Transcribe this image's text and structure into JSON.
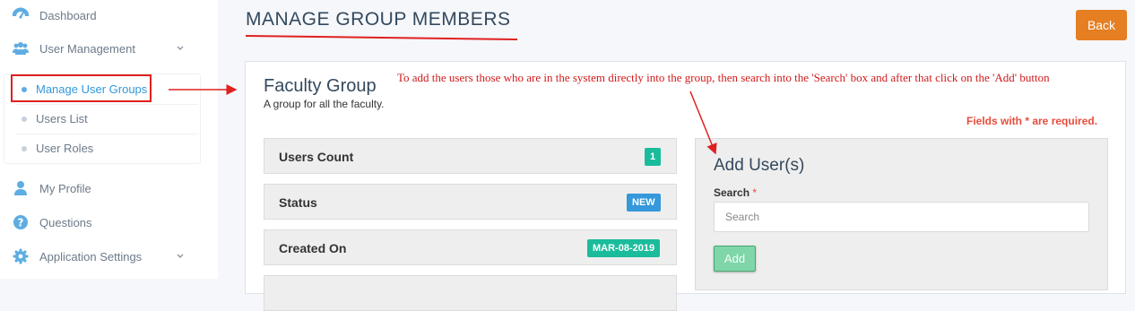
{
  "sidebar": {
    "items": [
      {
        "label": "Dashboard",
        "icon": "dashboard-icon"
      },
      {
        "label": "User Management",
        "icon": "users-icon"
      },
      {
        "label": "My Profile",
        "icon": "user-icon"
      },
      {
        "label": "Questions",
        "icon": "question-icon"
      },
      {
        "label": "Application Settings",
        "icon": "gear-icon"
      }
    ],
    "submenu": [
      {
        "label": "Manage User Groups",
        "active": true
      },
      {
        "label": "Users List"
      },
      {
        "label": "User Roles"
      }
    ]
  },
  "page": {
    "title": "MANAGE GROUP MEMBERS",
    "back_label": "Back"
  },
  "group": {
    "name": "Faculty Group",
    "description": "A group for all the faculty."
  },
  "annotation": {
    "note": "To add the users those who are in the system directly into the group, then search into the 'Search' box and after that click on the 'Add' button"
  },
  "required_note": "Fields with * are required.",
  "info": [
    {
      "label": "Users Count",
      "badge": "1",
      "badge_color": "#1abc9c"
    },
    {
      "label": "Status",
      "badge": "NEW",
      "badge_color": "#3498db"
    },
    {
      "label": "Created On",
      "badge": "MAR-08-2019",
      "badge_color": "#1abc9c"
    }
  ],
  "add_users": {
    "title": "Add User(s)",
    "search_label": "Search",
    "required_mark": "*",
    "search_placeholder": "Search",
    "search_value": "",
    "add_label": "Add"
  },
  "colors": {
    "accent": "#3498db",
    "back_button": "#e67e22",
    "annotation_red": "#e02020"
  }
}
